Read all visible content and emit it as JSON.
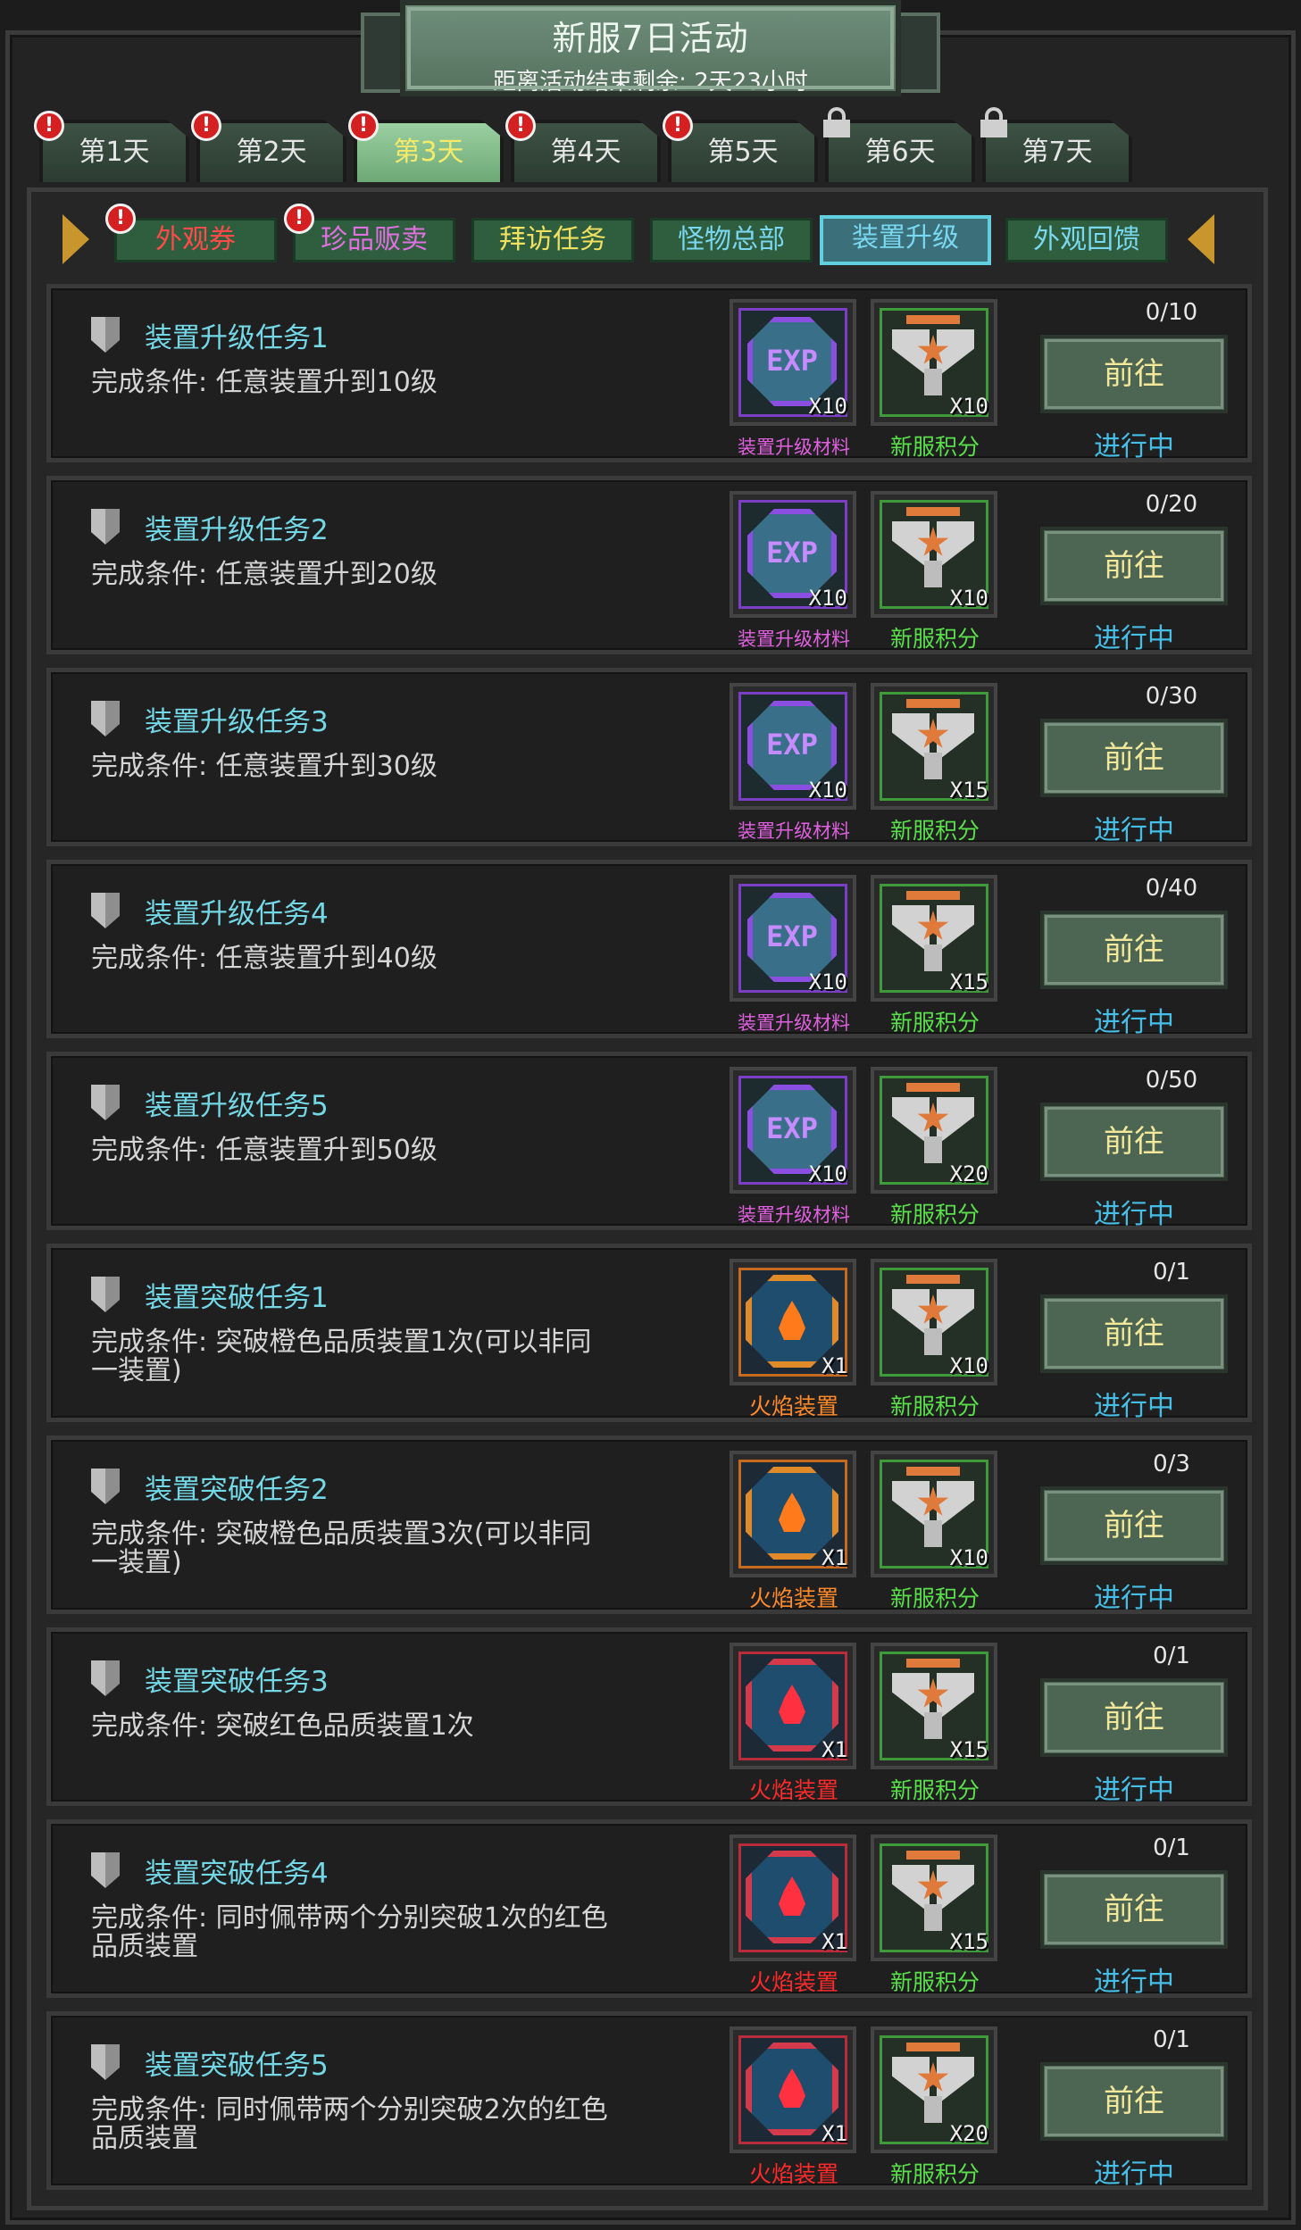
{
  "header": {
    "title": "新服7日活动",
    "countdown": "距离活动结束剩余: 2天23小时"
  },
  "day_tabs": [
    {
      "label": "第1天",
      "badge": "!",
      "locked": false,
      "active": false
    },
    {
      "label": "第2天",
      "badge": "!",
      "locked": false,
      "active": false
    },
    {
      "label": "第3天",
      "badge": "!",
      "locked": false,
      "active": true
    },
    {
      "label": "第4天",
      "badge": "!",
      "locked": false,
      "active": false
    },
    {
      "label": "第5天",
      "badge": "!",
      "locked": false,
      "active": false
    },
    {
      "label": "第6天",
      "badge": "",
      "locked": true,
      "active": false
    },
    {
      "label": "第7天",
      "badge": "",
      "locked": true,
      "active": false
    }
  ],
  "categories": [
    {
      "label": "外观券",
      "badge": "!",
      "color": "#ff4a4a",
      "active": false
    },
    {
      "label": "珍品贩卖",
      "badge": "!",
      "color": "#e070e0",
      "active": false
    },
    {
      "label": "拜访任务",
      "badge": "",
      "color": "#f0e060",
      "active": false
    },
    {
      "label": "怪物总部",
      "badge": "",
      "color": "#7ad7f0",
      "active": false
    },
    {
      "label": "装置升级",
      "badge": "",
      "color": "#7ad7f0",
      "active": true
    },
    {
      "label": "外观回馈",
      "badge": "",
      "color": "#7ad7f0",
      "active": false
    }
  ],
  "colors": {
    "task_title": "#73d7e6",
    "status": "#46bfe8",
    "label_material": "#e060e0",
    "label_points": "#59e04a",
    "label_orange_flame": "#ff8a2a",
    "label_red_flame": "#ff2a2a"
  },
  "tasks": [
    {
      "title": "装置升级任务1",
      "condition": "完成条件: 任意装置升到10级",
      "reward1": {
        "icon": "exp-icon",
        "coin_text": "EXP",
        "qty": "X10",
        "label": "装置升级材料"
      },
      "reward2": {
        "icon": "eagle-points-icon",
        "qty": "X10",
        "label": "新服积分"
      },
      "progress": "0/10",
      "button": "前往",
      "status": "进行中"
    },
    {
      "title": "装置升级任务2",
      "condition": "完成条件: 任意装置升到20级",
      "reward1": {
        "icon": "exp-icon",
        "coin_text": "EXP",
        "qty": "X10",
        "label": "装置升级材料"
      },
      "reward2": {
        "icon": "eagle-points-icon",
        "qty": "X10",
        "label": "新服积分"
      },
      "progress": "0/20",
      "button": "前往",
      "status": "进行中"
    },
    {
      "title": "装置升级任务3",
      "condition": "完成条件: 任意装置升到30级",
      "reward1": {
        "icon": "exp-icon",
        "coin_text": "EXP",
        "qty": "X10",
        "label": "装置升级材料"
      },
      "reward2": {
        "icon": "eagle-points-icon",
        "qty": "X15",
        "label": "新服积分"
      },
      "progress": "0/30",
      "button": "前往",
      "status": "进行中"
    },
    {
      "title": "装置升级任务4",
      "condition": "完成条件: 任意装置升到40级",
      "reward1": {
        "icon": "exp-icon",
        "coin_text": "EXP",
        "qty": "X10",
        "label": "装置升级材料"
      },
      "reward2": {
        "icon": "eagle-points-icon",
        "qty": "X15",
        "label": "新服积分"
      },
      "progress": "0/40",
      "button": "前往",
      "status": "进行中"
    },
    {
      "title": "装置升级任务5",
      "condition": "完成条件: 任意装置升到50级",
      "reward1": {
        "icon": "exp-icon",
        "coin_text": "EXP",
        "qty": "X10",
        "label": "装置升级材料"
      },
      "reward2": {
        "icon": "eagle-points-icon",
        "qty": "X20",
        "label": "新服积分"
      },
      "progress": "0/50",
      "button": "前往",
      "status": "进行中"
    },
    {
      "title": "装置突破任务1",
      "condition": "完成条件: 突破橙色品质装置1次(可以非同一装置)",
      "reward1": {
        "icon": "orange-flame-icon",
        "qty": "X1",
        "label": "火焰装置"
      },
      "reward2": {
        "icon": "eagle-points-icon",
        "qty": "X10",
        "label": "新服积分"
      },
      "progress": "0/1",
      "button": "前往",
      "status": "进行中"
    },
    {
      "title": "装置突破任务2",
      "condition": "完成条件: 突破橙色品质装置3次(可以非同一装置)",
      "reward1": {
        "icon": "orange-flame-icon",
        "qty": "X1",
        "label": "火焰装置"
      },
      "reward2": {
        "icon": "eagle-points-icon",
        "qty": "X10",
        "label": "新服积分"
      },
      "progress": "0/3",
      "button": "前往",
      "status": "进行中"
    },
    {
      "title": "装置突破任务3",
      "condition": "完成条件: 突破红色品质装置1次",
      "reward1": {
        "icon": "red-flame-icon",
        "qty": "X1",
        "label": "火焰装置"
      },
      "reward2": {
        "icon": "eagle-points-icon",
        "qty": "X15",
        "label": "新服积分"
      },
      "progress": "0/1",
      "button": "前往",
      "status": "进行中"
    },
    {
      "title": "装置突破任务4",
      "condition": "完成条件: 同时佩带两个分别突破1次的红色品质装置",
      "reward1": {
        "icon": "red-flame-icon",
        "qty": "X1",
        "label": "火焰装置"
      },
      "reward2": {
        "icon": "eagle-points-icon",
        "qty": "X15",
        "label": "新服积分"
      },
      "progress": "0/1",
      "button": "前往",
      "status": "进行中"
    },
    {
      "title": "装置突破任务5",
      "condition": "完成条件: 同时佩带两个分别突破2次的红色品质装置",
      "reward1": {
        "icon": "red-flame-icon",
        "qty": "X1",
        "label": "火焰装置"
      },
      "reward2": {
        "icon": "eagle-points-icon",
        "qty": "X20",
        "label": "新服积分"
      },
      "progress": "0/1",
      "button": "前往",
      "status": "进行中"
    }
  ]
}
